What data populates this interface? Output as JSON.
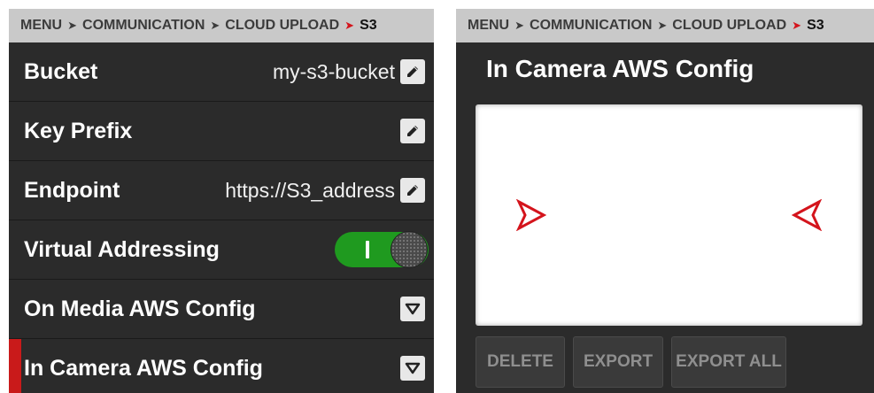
{
  "left": {
    "breadcrumb": {
      "items": [
        "MENU",
        "COMMUNICATION",
        "CLOUD UPLOAD",
        "S3"
      ]
    },
    "rows": [
      {
        "label": "Bucket",
        "value": "my-s3-bucket"
      },
      {
        "label": "Key Prefix",
        "value": ""
      },
      {
        "label": "Endpoint",
        "value": "https://S3_address"
      },
      {
        "label": "Virtual Addressing",
        "toggle_on": true
      },
      {
        "label": "On Media AWS Config"
      },
      {
        "label": "In Camera AWS Config",
        "selected": true
      }
    ]
  },
  "right": {
    "breadcrumb": {
      "items": [
        "MENU",
        "COMMUNICATION",
        "CLOUD UPLOAD",
        "S3"
      ]
    },
    "title": "In Camera AWS Config",
    "buttons": {
      "delete": "DELETE",
      "export": "EXPORT",
      "export_all": "EXPORT ALL"
    }
  },
  "colors": {
    "accent": "#d4141c",
    "toggle_on": "#1f9a1f",
    "panel_bg": "#2b2b2b",
    "breadcrumb_bg": "#c9c9c9"
  },
  "icons": [
    "pencil-icon",
    "chevron-down-icon",
    "arrow-right-icon",
    "arrow-left-icon",
    "breadcrumb-chevron-icon"
  ]
}
